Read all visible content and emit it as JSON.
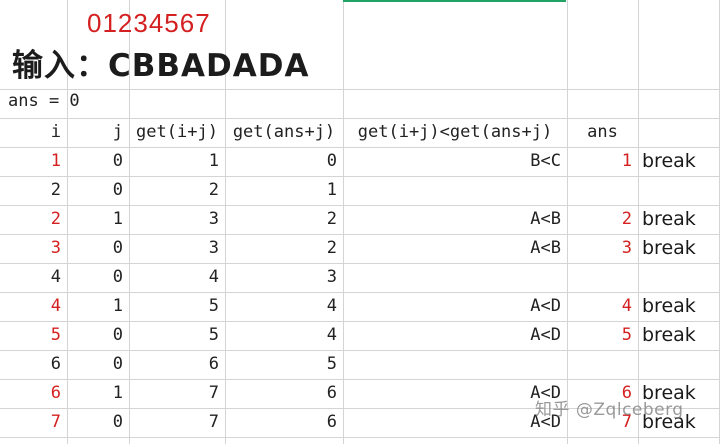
{
  "header": {
    "digits": "01234567",
    "input_label": "输入：CBBADADA"
  },
  "init_text": "ans = 0",
  "columns": [
    "i",
    "j",
    "get(i+j)",
    "get(ans+j)",
    "get(i+j)<get(ans+j)",
    "ans"
  ],
  "rows": [
    {
      "i": "1",
      "j": "0",
      "gij": "1",
      "gaj": "0",
      "cmp": "B<C",
      "ans": "1",
      "act": "break",
      "i_red": true
    },
    {
      "i": "2",
      "j": "0",
      "gij": "2",
      "gaj": "1",
      "cmp": "",
      "ans": "",
      "act": "",
      "i_red": false
    },
    {
      "i": "2",
      "j": "1",
      "gij": "3",
      "gaj": "2",
      "cmp": "A<B",
      "ans": "2",
      "act": "break",
      "i_red": true
    },
    {
      "i": "3",
      "j": "0",
      "gij": "3",
      "gaj": "2",
      "cmp": "A<B",
      "ans": "3",
      "act": "break",
      "i_red": true
    },
    {
      "i": "4",
      "j": "0",
      "gij": "4",
      "gaj": "3",
      "cmp": "",
      "ans": "",
      "act": "",
      "i_red": false
    },
    {
      "i": "4",
      "j": "1",
      "gij": "5",
      "gaj": "4",
      "cmp": "A<D",
      "ans": "4",
      "act": "break",
      "i_red": true
    },
    {
      "i": "5",
      "j": "0",
      "gij": "5",
      "gaj": "4",
      "cmp": "A<D",
      "ans": "5",
      "act": "break",
      "i_red": true
    },
    {
      "i": "6",
      "j": "0",
      "gij": "6",
      "gaj": "5",
      "cmp": "",
      "ans": "",
      "act": "",
      "i_red": false
    },
    {
      "i": "6",
      "j": "1",
      "gij": "7",
      "gaj": "6",
      "cmp": "A<D",
      "ans": "6",
      "act": "break",
      "i_red": true
    },
    {
      "i": "7",
      "j": "0",
      "gij": "7",
      "gaj": "6",
      "cmp": "A<D",
      "ans": "7",
      "act": "break",
      "i_red": true
    }
  ],
  "watermark": "知乎 @Zqlceberg",
  "colors": {
    "accent_red": "#d42020",
    "selection_green": "#21a366",
    "gridline": "#d4d4d4"
  }
}
